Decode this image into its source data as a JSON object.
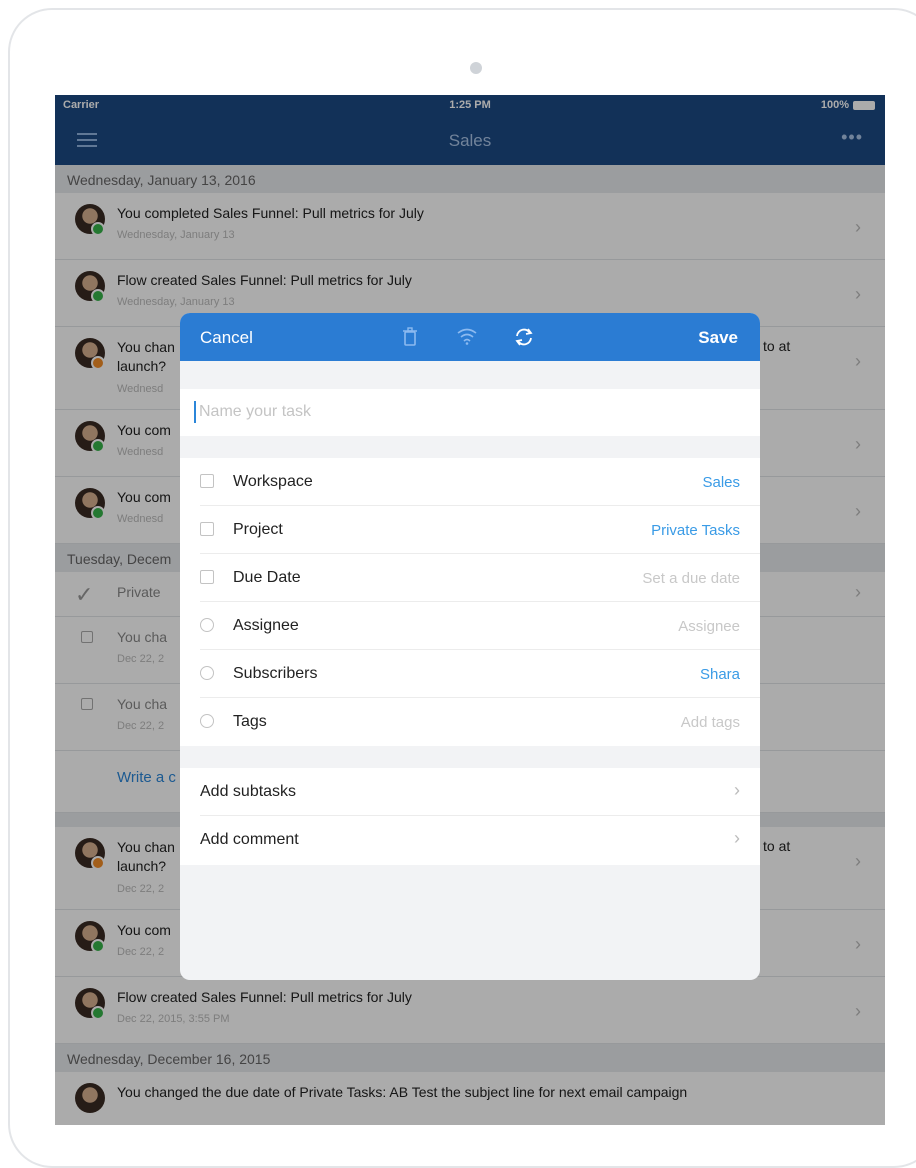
{
  "status": {
    "carrier": "Carrier",
    "time": "1:25 PM",
    "battery": "100%"
  },
  "nav": {
    "title": "Sales",
    "more": "•••"
  },
  "feed": {
    "section1": "Wednesday, January 13, 2016",
    "section2": "Tuesday, Decem",
    "section3": "Wednesday, December 16, 2015",
    "rows": [
      {
        "text": "You completed Sales Funnel: Pull metrics for July",
        "sub": "Wednesday, January 13"
      },
      {
        "text": "Flow created Sales Funnel: Pull metrics for July",
        "sub": "Wednesday, January 13"
      },
      {
        "text": "You chan",
        "tail": "to at",
        "line2": "launch?",
        "sub": "Wednesd"
      },
      {
        "text": "You com",
        "sub": "Wednesd"
      },
      {
        "text": "You com",
        "sub": "Wednesd"
      },
      {
        "text": "Private"
      },
      {
        "text": "You cha",
        "sub": "Dec 22, 2"
      },
      {
        "text": "You cha",
        "sub": "Dec 22, 2"
      },
      {
        "text": "Write a c"
      },
      {
        "text": "You chan",
        "tail": "to at",
        "line2": "launch?",
        "sub": "Dec 22, 2"
      },
      {
        "text": "You com",
        "sub": "Dec 22, 2"
      },
      {
        "text": "Flow created Sales Funnel: Pull metrics for July",
        "sub": "Dec 22, 2015, 3:55 PM"
      },
      {
        "text": "You changed the due date of Private Tasks: AB Test the subject line for next email campaign"
      }
    ]
  },
  "modal": {
    "cancel": "Cancel",
    "save": "Save",
    "name_placeholder": "Name your task",
    "fields": [
      {
        "label": "Workspace",
        "value": "Sales"
      },
      {
        "label": "Project",
        "value": "Private Tasks"
      },
      {
        "label": "Due Date",
        "value": "Set a due date"
      },
      {
        "label": "Assignee",
        "value": "Assignee"
      },
      {
        "label": "Subscribers",
        "value": "Shara"
      },
      {
        "label": "Tags",
        "value": "Add tags"
      }
    ],
    "links": [
      {
        "label": "Add subtasks",
        "chevron": "›"
      },
      {
        "label": "Add comment",
        "chevron": "›"
      }
    ]
  },
  "colors": {
    "nav": "#1c4a84",
    "modal_header": "#2b7cd3",
    "link_blue": "#3a9be6",
    "check_badge": "#37b34a",
    "pending_badge": "#f28c28"
  }
}
